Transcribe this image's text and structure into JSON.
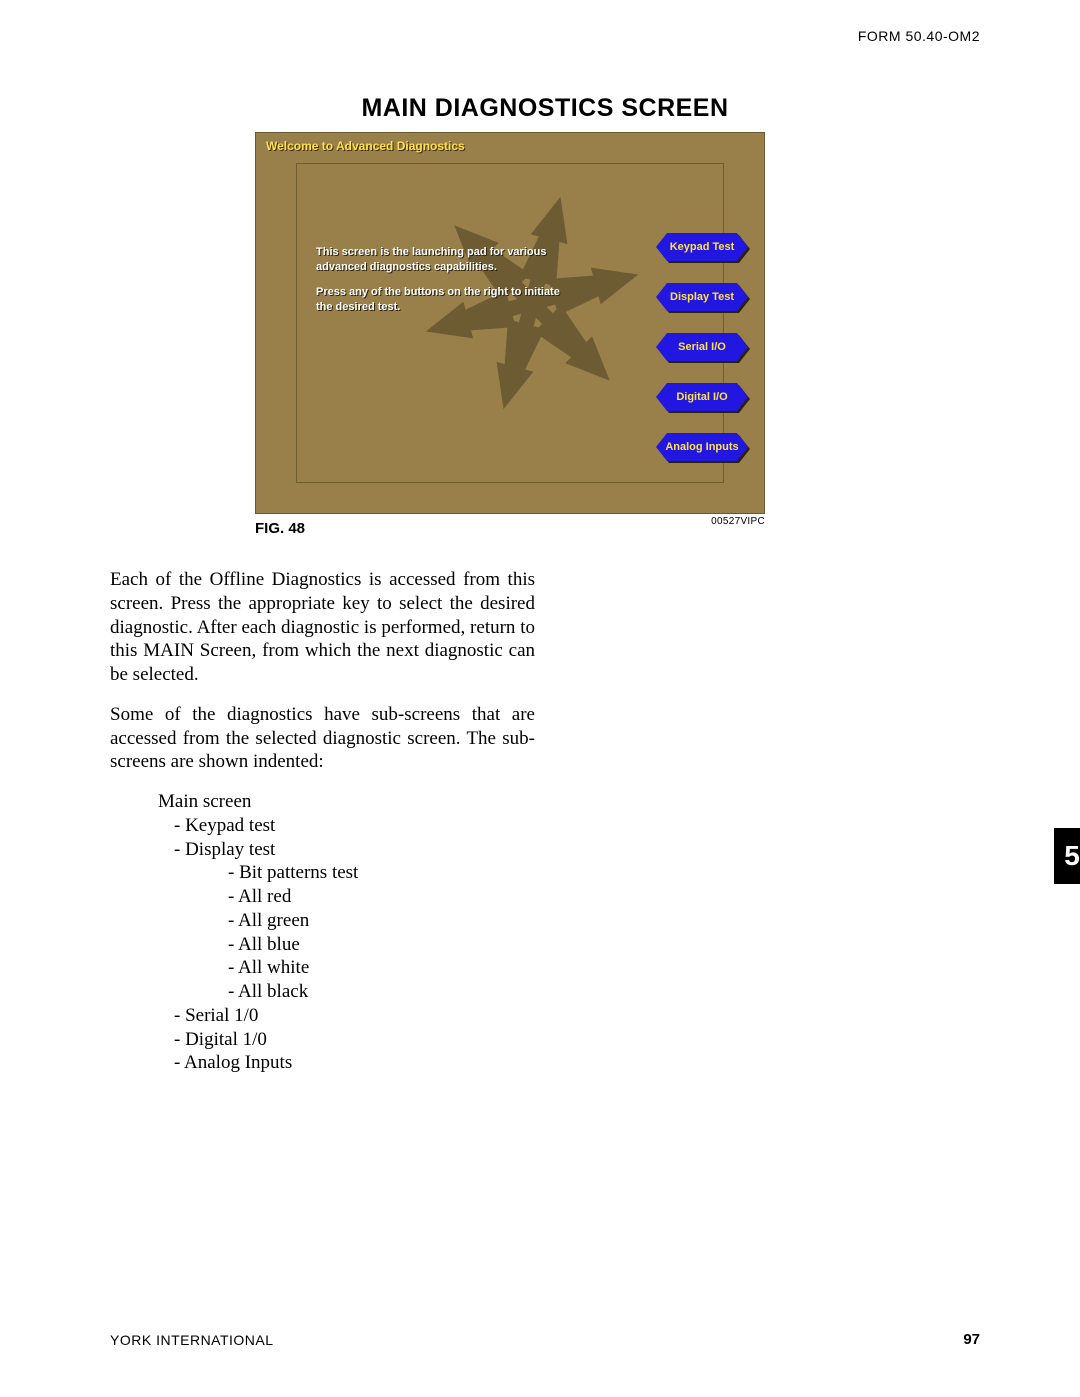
{
  "header": {
    "form_no": "FORM 50.40-OM2",
    "title": "MAIN DIAGNOSTICS SCREEN"
  },
  "figure": {
    "label": "FIG. 48",
    "code": "00527VIPC",
    "screen": {
      "welcome": "Welcome to Advanced Diagnostics",
      "line1": "This screen is the launching pad for various advanced diagnostics capabilities.",
      "line2": "Press any of the buttons on the right to initiate the desired test.",
      "buttons": {
        "b0": "Keypad Test",
        "b1": "Display Test",
        "b2": "Serial I/O",
        "b3": "Digital I/O",
        "b4": "Analog Inputs"
      }
    }
  },
  "body": {
    "p1": "Each of the Offline Diagnostics is accessed from this screen. Press the appropriate key to select the desired diagnostic. After each diagnostic is performed, return to this MAIN Screen, from which the next diagnostic can be selected.",
    "p2": "Some of the diagnostics have sub-screens that are accessed from the selected diagnostic screen. The sub-screens are shown indented:",
    "tree": {
      "main": "Main screen",
      "keypad": "- Keypad test",
      "display": "- Display test",
      "bit": "- Bit patterns test",
      "red": "- All red",
      "green": "- All green",
      "blue": "- All blue",
      "white": "- All white",
      "black": "- All black",
      "serial": "- Serial 1/0",
      "digital": "- Digital 1/0",
      "analog": "- Analog Inputs"
    }
  },
  "side_tab": "5",
  "footer": {
    "left": "YORK INTERNATIONAL",
    "page": "97"
  }
}
